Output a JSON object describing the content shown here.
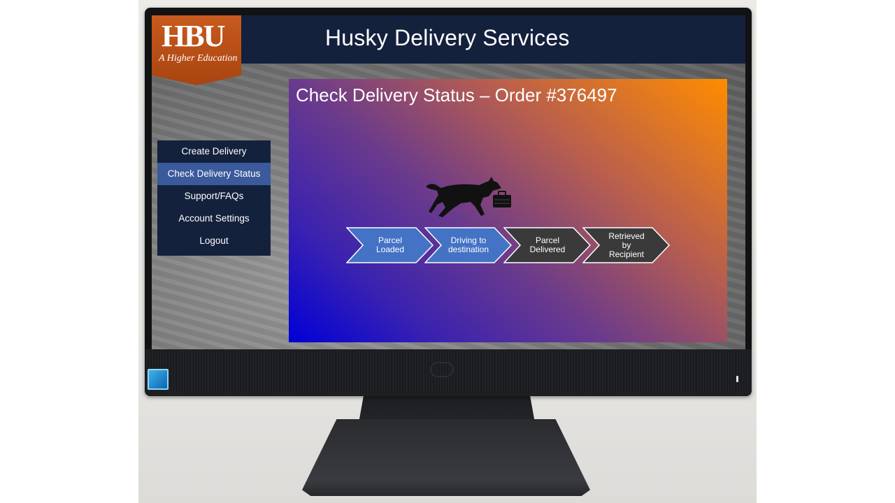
{
  "header": {
    "title": "Husky Delivery Services",
    "logo_main": "HBU",
    "logo_sub": "A Higher Education"
  },
  "nav": {
    "items": [
      {
        "label": "Create Delivery",
        "active": false
      },
      {
        "label": "Check Delivery Status",
        "active": true
      },
      {
        "label": "Support/FAQs",
        "active": false
      },
      {
        "label": "Account Settings",
        "active": false
      },
      {
        "label": "Logout",
        "active": false
      }
    ]
  },
  "main": {
    "title": "Check Delivery Status – Order #376497",
    "mascot_icon": "husky-running-with-briefcase-icon",
    "steps": [
      {
        "label": "Parcel\nLoaded",
        "color": "#4472c4"
      },
      {
        "label": "Driving to\ndestination",
        "color": "#4472c4"
      },
      {
        "label": "Parcel\nDelivered",
        "color": "#3a3a3a"
      },
      {
        "label": "Retrieved\nby\nRecipient",
        "color": "#3a3a3a"
      }
    ]
  },
  "colors": {
    "header_bg": "#14213d",
    "nav_active": "#3a5a9c",
    "logo_orange": "#c85a1e",
    "gradient_start": "#0000d8",
    "gradient_end": "#ff8c00"
  }
}
